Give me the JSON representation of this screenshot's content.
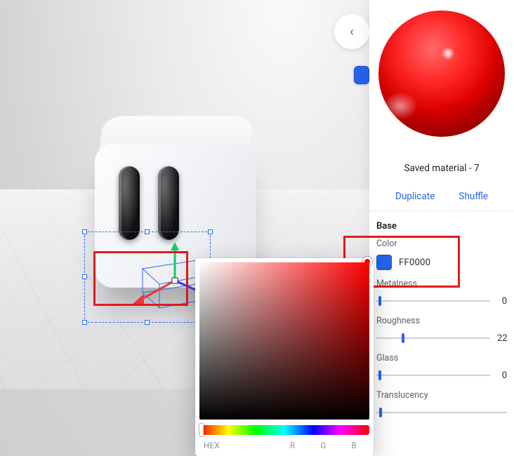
{
  "material": {
    "name": "Saved material - 7",
    "actions": {
      "duplicate": "Duplicate",
      "shuffle": "Shuffle"
    }
  },
  "panel": {
    "section_base": "Base",
    "color": {
      "label": "Color",
      "hex": "FF0000",
      "swatch_hex": "#2563eb"
    },
    "metalness": {
      "label": "Metalness",
      "value": "0",
      "pct": 2
    },
    "roughness": {
      "label": "Roughness",
      "value": "22",
      "pct": 22
    },
    "glass": {
      "label": "Glass",
      "value": "0",
      "pct": 2
    },
    "translucency": {
      "label": "Translucency",
      "pct": 2
    }
  },
  "picker": {
    "hex_label": "HEX",
    "r_label": "R",
    "g_label": "G",
    "b_label": "B"
  },
  "top_buttons": {
    "back_glyph": "‹"
  }
}
